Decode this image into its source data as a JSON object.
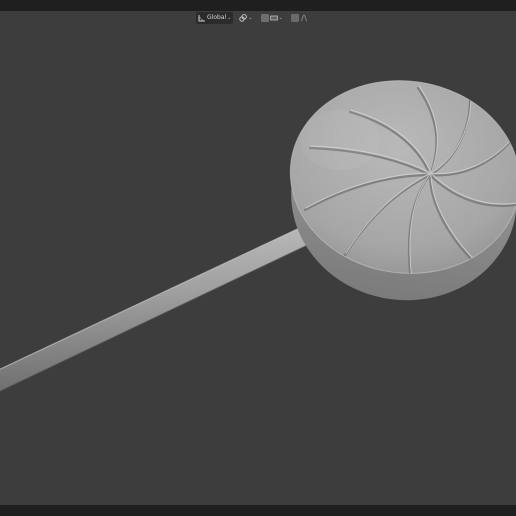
{
  "header": {
    "orientation": {
      "icon": "transform-orientation-icon",
      "label": "Global"
    },
    "pivot": {
      "icon": "pivot-point-icon"
    },
    "snapping": {
      "icon": "snap-increment-icon",
      "suffix": "ᵢₙc"
    },
    "proportional": {
      "icon": "proportional-editing-icon"
    },
    "falloff": {
      "icon": "falloff-curve-icon"
    }
  },
  "colors": {
    "topbar": "#1f1f1f",
    "viewport": "#3d3d3d",
    "mesh": "#a8a8a8"
  }
}
